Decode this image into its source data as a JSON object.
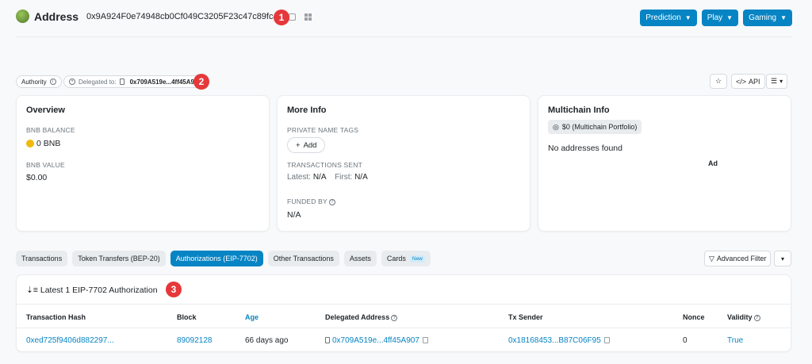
{
  "header": {
    "title": "Address",
    "address": "0x9A924F0e74948cb0Cf049C3205F23c47c89fc4d6",
    "buttons": [
      {
        "label": "Prediction"
      },
      {
        "label": "Play"
      },
      {
        "label": "Gaming"
      }
    ]
  },
  "markers": [
    "1",
    "2",
    "3"
  ],
  "badges": {
    "authority": "Authority",
    "delegated_label": "Delegated to:",
    "delegated_addr": "0x709A519e...4ff45A907"
  },
  "actions": {
    "api": "API"
  },
  "overview": {
    "title": "Overview",
    "bnb_balance_label": "BNB BALANCE",
    "bnb_balance": "0 BNB",
    "bnb_value_label": "BNB VALUE",
    "bnb_value": "$0.00"
  },
  "more_info": {
    "title": "More Info",
    "tags_label": "PRIVATE NAME TAGS",
    "add_label": "Add",
    "tx_sent_label": "TRANSACTIONS SENT",
    "latest_label": "Latest:",
    "latest_value": "N/A",
    "first_label": "First:",
    "first_value": "N/A",
    "funded_label": "FUNDED BY",
    "funded_value": "N/A"
  },
  "multichain": {
    "title": "Multichain Info",
    "portfolio": "$0 (Multichain Portfolio)",
    "empty": "No addresses found",
    "ad": "Ad"
  },
  "tabs": [
    {
      "label": "Transactions"
    },
    {
      "label": "Token Transfers (BEP-20)"
    },
    {
      "label": "Authorizations (EIP-7702)"
    },
    {
      "label": "Other Transactions"
    },
    {
      "label": "Assets"
    },
    {
      "label": "Cards"
    }
  ],
  "new_badge": "New",
  "filter": {
    "label": "Advanced Filter"
  },
  "table": {
    "heading": "Latest 1 EIP-7702 Authorization",
    "columns": [
      "Transaction Hash",
      "Block",
      "Age",
      "Delegated Address",
      "Tx Sender",
      "Nonce",
      "Validity"
    ],
    "row": {
      "hash": "0xed725f9406d882297...",
      "block": "89092128",
      "age": "66 days ago",
      "delegated": "0x709A519e...4ff45A907",
      "sender": "0x18168453...B87C06F95",
      "nonce": "0",
      "validity": "True"
    }
  },
  "colors": {
    "accent": "#0784c3",
    "marker": "#e5383b",
    "bnb": "#f0b90b"
  }
}
